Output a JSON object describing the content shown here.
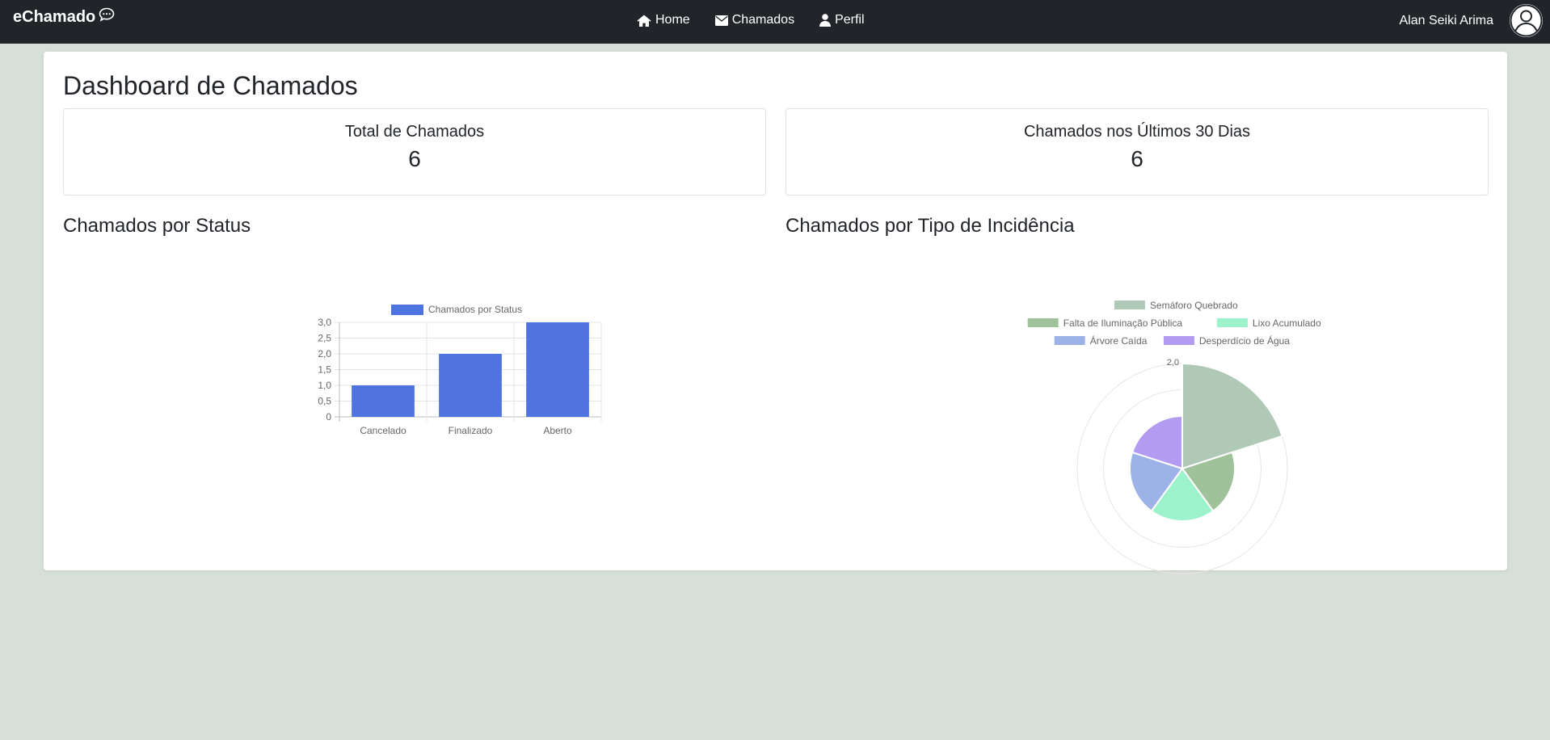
{
  "navbar": {
    "brand": "eChamado",
    "links": [
      {
        "label": "Home",
        "icon": "home-icon"
      },
      {
        "label": "Chamados",
        "icon": "envelope-icon"
      },
      {
        "label": "Perfil",
        "icon": "user-icon"
      }
    ],
    "user_name": "Alan Seiki Arima"
  },
  "dashboard": {
    "title": "Dashboard de Chamados",
    "stats": [
      {
        "label": "Total de Chamados",
        "value": "6"
      },
      {
        "label": "Chamados nos Últimos 30 Dias",
        "value": "6"
      }
    ],
    "status_section_title": "Chamados por Status",
    "type_section_title": "Chamados por Tipo de Incidência"
  },
  "colors": {
    "navbar": "#212529",
    "page_background": "#d6e0d8",
    "bar": "#4f74e0"
  },
  "chart_data": [
    {
      "type": "bar",
      "categories": [
        "Cancelado",
        "Finalizado",
        "Aberto"
      ],
      "series": [
        {
          "name": "Chamados por Status",
          "values": [
            1,
            2,
            3
          ],
          "color": "#4f74e0"
        }
      ],
      "ylim": [
        0,
        3
      ],
      "yticks": [
        "0",
        "0,5",
        "1,0",
        "1,5",
        "2,0",
        "2,5",
        "3,0"
      ],
      "legend": "top",
      "grid": true
    },
    {
      "type": "polarArea",
      "categories": [
        "Semáforo Quebrado",
        "Falta de Iluminação Pública",
        "Lixo Acumulado",
        "Árvore Caída",
        "Desperdício de Água"
      ],
      "values": [
        2,
        1,
        1,
        1,
        1
      ],
      "colors": [
        "#b0c8b6",
        "#9fc29a",
        "#9cf2cb",
        "#9db3e8",
        "#b29bf1"
      ],
      "rmax": 2,
      "ticks": [
        "2,0"
      ],
      "legend": "top"
    }
  ]
}
